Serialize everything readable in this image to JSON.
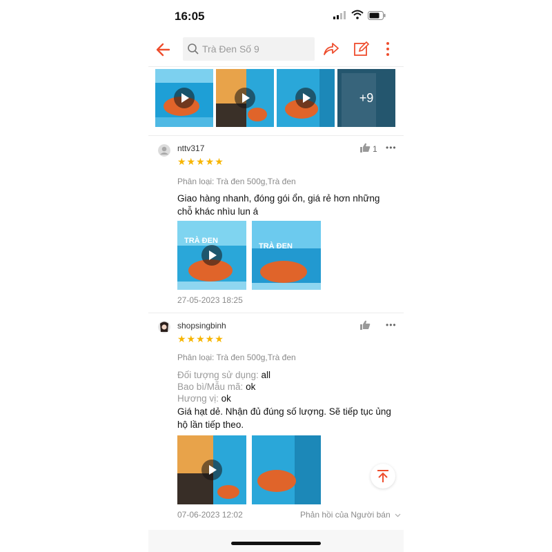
{
  "status_bar": {
    "time": "16:05"
  },
  "header": {
    "search_placeholder": "Trà Đen Số 9"
  },
  "top_gallery": {
    "more_count": "+9"
  },
  "reviews": [
    {
      "username": "nttv317",
      "like_count": "1",
      "stars": "★★★★★",
      "variant": "Phân loại: Trà đen 500g,Trà đen",
      "text": "Giao hàng nhanh, đóng gói ổn, giá rẻ hơn những chỗ khác nhìu lun á",
      "date": "27-05-2023 18:25"
    },
    {
      "username": "shopsingbinh",
      "stars": "★★★★★",
      "variant": "Phân loại: Trà đen 500g,Trà đen",
      "attributes": [
        {
          "key": "Đối tượng sử dụng: ",
          "value": "all"
        },
        {
          "key": "Bao bì/Mẫu mã: ",
          "value": "ok"
        },
        {
          "key": "Hương vị: ",
          "value": "ok"
        }
      ],
      "text": "Giá hạt dẻ. Nhận đủ đúng số lượng. Sẽ tiếp tục ủng hộ lần tiếp theo.",
      "date": "07-06-2023 12:02",
      "seller_reply": "Phản hồi của Người bán"
    }
  ],
  "colors": {
    "accent": "#ee4d2d",
    "star": "#f7b500",
    "tea_blue": "#2aa7d9",
    "tea_orange": "#e0642a"
  },
  "icons": [
    "back-arrow-icon",
    "search-icon",
    "share-icon",
    "edit-icon",
    "more-vertical-icon",
    "thumbs-up-icon",
    "more-horizontal-icon",
    "play-icon",
    "scroll-to-top-icon"
  ]
}
